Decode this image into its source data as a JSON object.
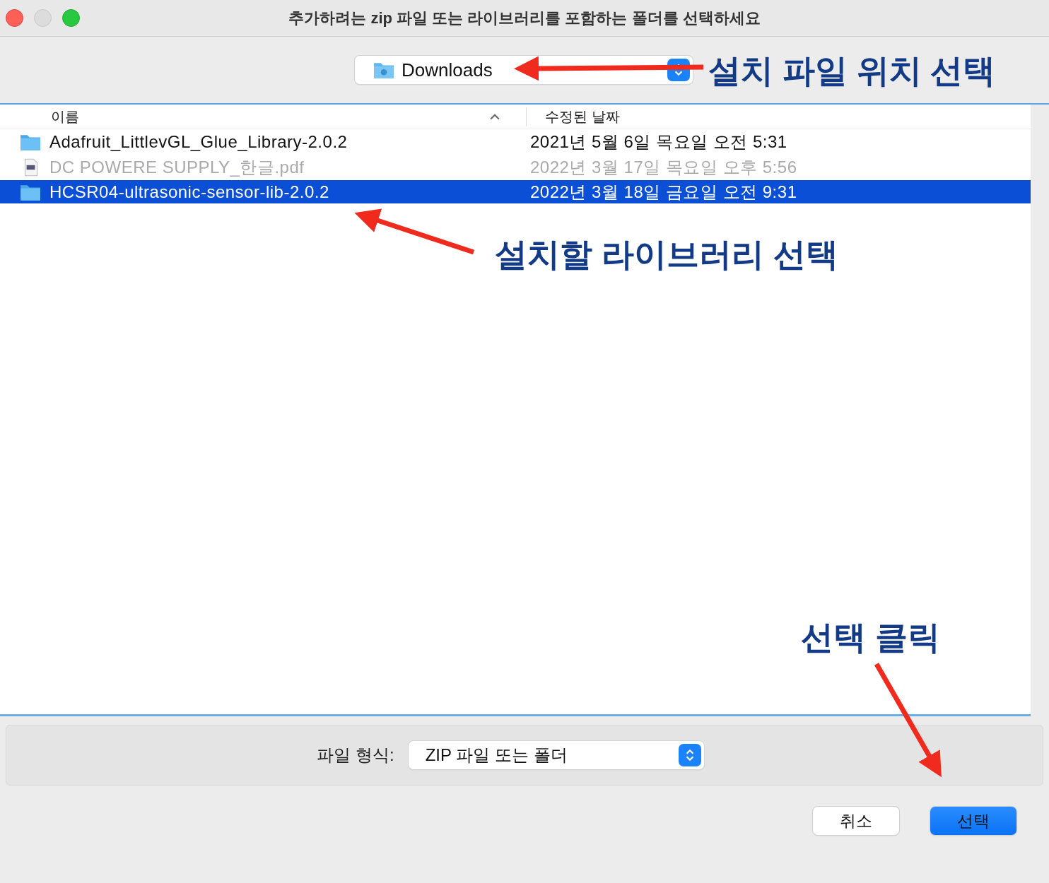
{
  "window": {
    "title": "추가하려는 zip 파일 또는 라이브러리를 포함하는 폴더를 선택하세요"
  },
  "location": {
    "value": "Downloads"
  },
  "table": {
    "columns": [
      "이름",
      "수정된 날짜"
    ],
    "rows": [
      {
        "kind": "folder",
        "name": "Adafruit_LittlevGL_Glue_Library-2.0.2",
        "date": "2021년 5월 6일 목요일 오전 5:31",
        "disabled": false,
        "selected": false
      },
      {
        "kind": "pdf",
        "name": "DC POWERE SUPPLY_한글.pdf",
        "date": "2022년 3월 17일 목요일 오후 5:56",
        "disabled": true,
        "selected": false
      },
      {
        "kind": "folder",
        "name": "HCSR04-ultrasonic-sensor-lib-2.0.2",
        "date": "2022년 3월 18일 금요일 오전 9:31",
        "disabled": false,
        "selected": true
      }
    ]
  },
  "file_format": {
    "label": "파일 형식:",
    "value": "ZIP 파일 또는 폴더"
  },
  "buttons": [
    {
      "label": "취소",
      "kind": "cancel"
    },
    {
      "label": "선택",
      "kind": "default"
    }
  ],
  "annotations": [
    "설치 파일 위치 선택",
    "설치할 라이브러리 선택",
    "선택 클릭"
  ]
}
